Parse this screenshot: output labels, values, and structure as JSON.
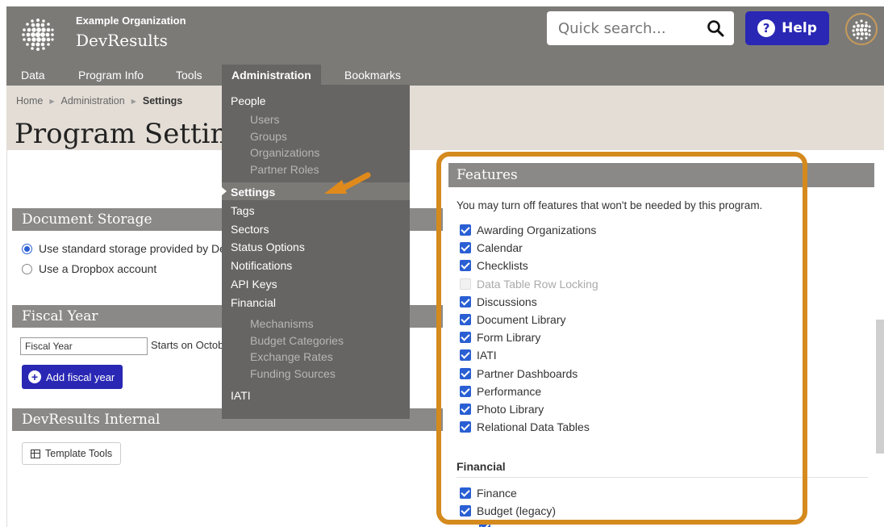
{
  "header": {
    "org_name": "Example Organization",
    "app_name": "DevResults",
    "search_placeholder": "Quick search...",
    "help_label": "Help"
  },
  "nav": {
    "items": [
      "Data",
      "Program Info",
      "Tools",
      "Administration",
      "Bookmarks"
    ],
    "active": "Administration"
  },
  "breadcrumb": {
    "items": [
      "Home",
      "Administration",
      "Settings"
    ]
  },
  "page_title": "Program Settings",
  "sections": {
    "document_storage": {
      "title": "Document Storage",
      "options": [
        "Use standard storage provided by DevResults",
        "Use a Dropbox account"
      ],
      "selected_index": 0
    },
    "fiscal_year": {
      "title": "Fiscal Year",
      "input_value": "Fiscal Year",
      "starts_text": "Starts on October",
      "add_button": "Add fiscal year"
    },
    "devresults_internal": {
      "title": "DevResults Internal",
      "template_button": "Template Tools"
    }
  },
  "admin_menu": {
    "people": "People",
    "people_sub": [
      "Users",
      "Groups",
      "Organizations",
      "Partner Roles"
    ],
    "items": [
      "Settings",
      "Tags",
      "Sectors",
      "Status Options",
      "Notifications",
      "API Keys",
      "Financial"
    ],
    "financial_sub": [
      "Mechanisms",
      "Budget Categories",
      "Exchange Rates",
      "Funding Sources"
    ],
    "last": "IATI",
    "selected": "Settings"
  },
  "features": {
    "title": "Features",
    "description": "You may turn off features that won't be needed by this program.",
    "items": [
      {
        "label": "Awarding Organizations",
        "checked": true
      },
      {
        "label": "Calendar",
        "checked": true
      },
      {
        "label": "Checklists",
        "checked": true
      },
      {
        "label": "Data Table Row Locking",
        "checked": false,
        "disabled": true
      },
      {
        "label": "Discussions",
        "checked": true
      },
      {
        "label": "Document Library",
        "checked": true
      },
      {
        "label": "Form Library",
        "checked": true
      },
      {
        "label": "IATI",
        "checked": true
      },
      {
        "label": "Partner Dashboards",
        "checked": true
      },
      {
        "label": "Performance",
        "checked": true
      },
      {
        "label": "Photo Library",
        "checked": true
      },
      {
        "label": "Relational Data Tables",
        "checked": true
      }
    ],
    "financial_title": "Financial",
    "financial_items": [
      {
        "label": "Finance",
        "checked": true
      },
      {
        "label": "Budget (legacy)",
        "checked": true
      }
    ]
  },
  "colors": {
    "header_bg": "#7b7a77",
    "menu_bg": "#666563",
    "accent_blue": "#2927b4",
    "checkbox_blue": "#2a5fd3",
    "highlight_orange": "#d58a1e"
  }
}
